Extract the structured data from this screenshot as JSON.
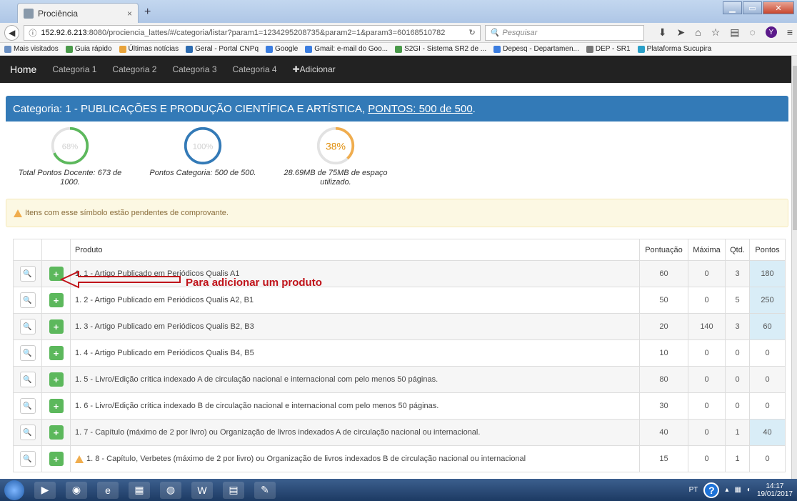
{
  "browser": {
    "tab_title": "Prociência",
    "tab_close": "×",
    "new_tab": "+",
    "url_host": "152.92.6.213",
    "url_rest": ":8080/prociencia_lattes/#/categoria/listar?param1=1234295208735&param2=1&param3=60168510782",
    "search_placeholder": "Pesquisar",
    "bookmarks": [
      "Mais visitados",
      "Guia rápido",
      "Últimas notícias",
      "Geral - Portal CNPq",
      "Google",
      "Gmail: e-mail do Goo...",
      "S2GI - Sistema SR2 de ...",
      "Depesq - Departamen...",
      "DEP - SR1",
      "Plataforma Sucupira"
    ],
    "colors": {
      "titlebar": "#aec6e6",
      "close": "#c8452d"
    }
  },
  "appnav": {
    "home": "Home",
    "items": [
      "Categoria 1",
      "Categoria 2",
      "Categoria 3",
      "Categoria 4"
    ],
    "add": "Adicionar"
  },
  "panel": {
    "title": "Categoria: 1 - PUBLICAÇÕES E PRODUÇÃO CIENTÍFICA E ARTÍSTICA,",
    "points": "PONTOS: 500 de 500",
    "points_suffix": ".",
    "color": "#337ab7"
  },
  "gauges": [
    {
      "label": "68%",
      "value": 0.68,
      "caption": "Total Pontos Docente: 673 de 1000.",
      "color": "#5cb85c",
      "text_color": "#cfcfcf"
    },
    {
      "label": "100%",
      "value": 1.0,
      "caption": "Pontos Categoria: 500 de 500.",
      "color": "#337ab7",
      "text_color": "#cfcfcf"
    },
    {
      "label": "38%",
      "value": 0.38,
      "caption": "28.69MB de 75MB de espaço utilizado.",
      "color": "#f0ad4e",
      "text_color": "#e08e0b"
    }
  ],
  "alert": {
    "text": "Itens com esse símbolo estão pendentes de comprovante."
  },
  "table": {
    "headers": [
      "Produto",
      "Pontuação",
      "Máxima",
      "Qtd.",
      "Pontos"
    ],
    "rows": [
      {
        "name": "1. 1 - Artigo Publicado em Periódicos Qualis A1",
        "pontuacao": "60",
        "maxima": "0",
        "qtd": "3",
        "pontos": "180",
        "warn": false,
        "hl": true
      },
      {
        "name": "1. 2 - Artigo Publicado em Periódicos Qualis A2, B1",
        "pontuacao": "50",
        "maxima": "0",
        "qtd": "5",
        "pontos": "250",
        "warn": false,
        "hl": true
      },
      {
        "name": "1. 3 - Artigo Publicado em Periódicos Qualis B2, B3",
        "pontuacao": "20",
        "maxima": "140",
        "qtd": "3",
        "pontos": "60",
        "warn": false,
        "hl": true
      },
      {
        "name": "1. 4 - Artigo Publicado em Periódicos Qualis B4, B5",
        "pontuacao": "10",
        "maxima": "0",
        "qtd": "0",
        "pontos": "0",
        "warn": false,
        "hl": false
      },
      {
        "name": "1. 5 - Livro/Edição crítica indexado A de circulação nacional e internacional com pelo menos 50 páginas.",
        "pontuacao": "80",
        "maxima": "0",
        "qtd": "0",
        "pontos": "0",
        "warn": false,
        "hl": false
      },
      {
        "name": "1. 6 - Livro/Edição crítica indexado B de circulação nacional e internacional com pelo menos 50 páginas.",
        "pontuacao": "30",
        "maxima": "0",
        "qtd": "0",
        "pontos": "0",
        "warn": false,
        "hl": false
      },
      {
        "name": "1. 7 - Capítulo (máximo de 2 por livro) ou Organização de livros indexados A de circulação nacional ou internacional.",
        "pontuacao": "40",
        "maxima": "0",
        "qtd": "1",
        "pontos": "40",
        "warn": false,
        "hl": true
      },
      {
        "name": "1. 8 - Capítulo, Verbetes (máximo de 2 por livro) ou Organização de livros indexados B de circulação nacional ou internacional",
        "pontuacao": "15",
        "maxima": "0",
        "qtd": "1",
        "pontos": "0",
        "warn": true,
        "hl": false
      }
    ]
  },
  "annotation": {
    "text": "Para adicionar um produto",
    "color": "#c0131a"
  },
  "taskbar": {
    "lang": "PT",
    "time": "14:17",
    "date": "19/01/2017"
  }
}
